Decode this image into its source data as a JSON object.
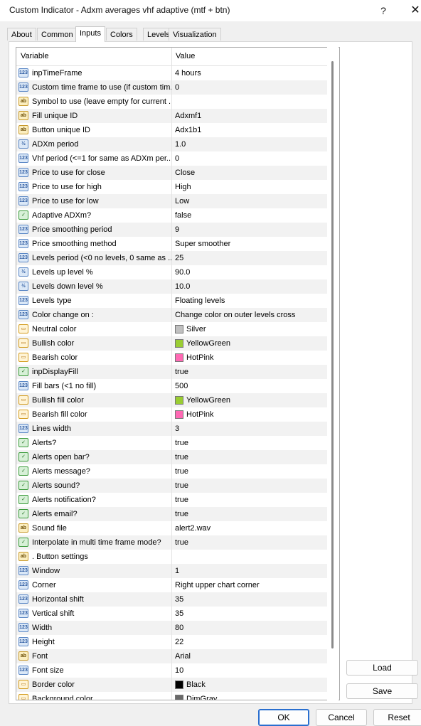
{
  "window": {
    "title": "Custom Indicator - Adxm averages vhf adaptive (mtf + btn)",
    "help_glyph": "?",
    "close_glyph": "✕"
  },
  "tabs": [
    "About",
    "Common",
    "Inputs",
    "Colors",
    "Levels",
    "Visualization"
  ],
  "active_tab": "Inputs",
  "grid": {
    "header_variable": "Variable",
    "header_value": "Value",
    "rows": [
      {
        "type": "123",
        "var": "inpTimeFrame",
        "val": "4 hours"
      },
      {
        "type": "123",
        "var": "Custom time frame to use (if custom tim...",
        "val": "0"
      },
      {
        "type": "ab",
        "var": "Symbol to use (leave empty for current ...",
        "val": ""
      },
      {
        "type": "ab",
        "var": "Fill unique ID",
        "val": "Adxmf1"
      },
      {
        "type": "ab",
        "var": "Button unique ID",
        "val": "Adx1b1"
      },
      {
        "type": "½",
        "var": "ADXm period",
        "val": "1.0"
      },
      {
        "type": "123",
        "var": "Vhf period (<=1 for same as ADXm per...",
        "val": "0"
      },
      {
        "type": "123",
        "var": "Price to use for close",
        "val": "Close"
      },
      {
        "type": "123",
        "var": "Price to use for high",
        "val": "High"
      },
      {
        "type": "123",
        "var": "Price to use for low",
        "val": "Low"
      },
      {
        "type": "bool",
        "var": "Adaptive ADXm?",
        "val": "false"
      },
      {
        "type": "123",
        "var": "Price smoothing period",
        "val": "9"
      },
      {
        "type": "123",
        "var": "Price smoothing method",
        "val": "Super smoother"
      },
      {
        "type": "123",
        "var": "Levels period (<0 no levels, 0 same as ...",
        "val": "25"
      },
      {
        "type": "½",
        "var": "Levels up level %",
        "val": "90.0"
      },
      {
        "type": "½",
        "var": "Levels down level %",
        "val": "10.0"
      },
      {
        "type": "123",
        "var": "Levels type",
        "val": "Floating levels"
      },
      {
        "type": "123",
        "var": "Color change on :",
        "val": "Change color on outer levels cross"
      },
      {
        "type": "clr",
        "var": "Neutral color",
        "val": "Silver",
        "swatch": "#c0c0c0"
      },
      {
        "type": "clr",
        "var": "Bullish color",
        "val": "YellowGreen",
        "swatch": "#9acd32"
      },
      {
        "type": "clr",
        "var": "Bearish color",
        "val": "HotPink",
        "swatch": "#ff69b4"
      },
      {
        "type": "bool",
        "var": "inpDisplayFill",
        "val": "true"
      },
      {
        "type": "123",
        "var": "Fill bars (<1 no fill)",
        "val": "500"
      },
      {
        "type": "clr",
        "var": "Bullish fill color",
        "val": "YellowGreen",
        "swatch": "#9acd32"
      },
      {
        "type": "clr",
        "var": "Bearish fill color",
        "val": "HotPink",
        "swatch": "#ff69b4"
      },
      {
        "type": "123",
        "var": "Lines width",
        "val": "3"
      },
      {
        "type": "bool",
        "var": "Alerts?",
        "val": "true"
      },
      {
        "type": "bool",
        "var": "Alerts open bar?",
        "val": "true"
      },
      {
        "type": "bool",
        "var": "Alerts message?",
        "val": "true"
      },
      {
        "type": "bool",
        "var": "Alerts sound?",
        "val": "true"
      },
      {
        "type": "bool",
        "var": "Alerts notification?",
        "val": "true"
      },
      {
        "type": "bool",
        "var": "Alerts email?",
        "val": "true"
      },
      {
        "type": "ab",
        "var": "Sound file",
        "val": "alert2.wav"
      },
      {
        "type": "bool",
        "var": "Interpolate in multi time frame mode?",
        "val": "true"
      },
      {
        "type": "ab",
        "var": ".    Button settings",
        "val": ""
      },
      {
        "type": "123",
        "var": "Window",
        "val": "1"
      },
      {
        "type": "123",
        "var": "Corner",
        "val": "Right upper chart corner"
      },
      {
        "type": "123",
        "var": "Horizontal shift",
        "val": "35"
      },
      {
        "type": "123",
        "var": "Vertical shift",
        "val": "35"
      },
      {
        "type": "123",
        "var": "Width",
        "val": "80"
      },
      {
        "type": "123",
        "var": "Height",
        "val": "22"
      },
      {
        "type": "ab",
        "var": "Font",
        "val": "Arial"
      },
      {
        "type": "123",
        "var": "Font size",
        "val": "10"
      },
      {
        "type": "clr",
        "var": "Border color",
        "val": "Black",
        "swatch": "#000000"
      },
      {
        "type": "clr",
        "var": "Background color",
        "val": "DimGray",
        "swatch": "#696969"
      }
    ]
  },
  "buttons": {
    "load": "Load",
    "save": "Save",
    "ok": "OK",
    "cancel": "Cancel",
    "reset": "Reset"
  }
}
